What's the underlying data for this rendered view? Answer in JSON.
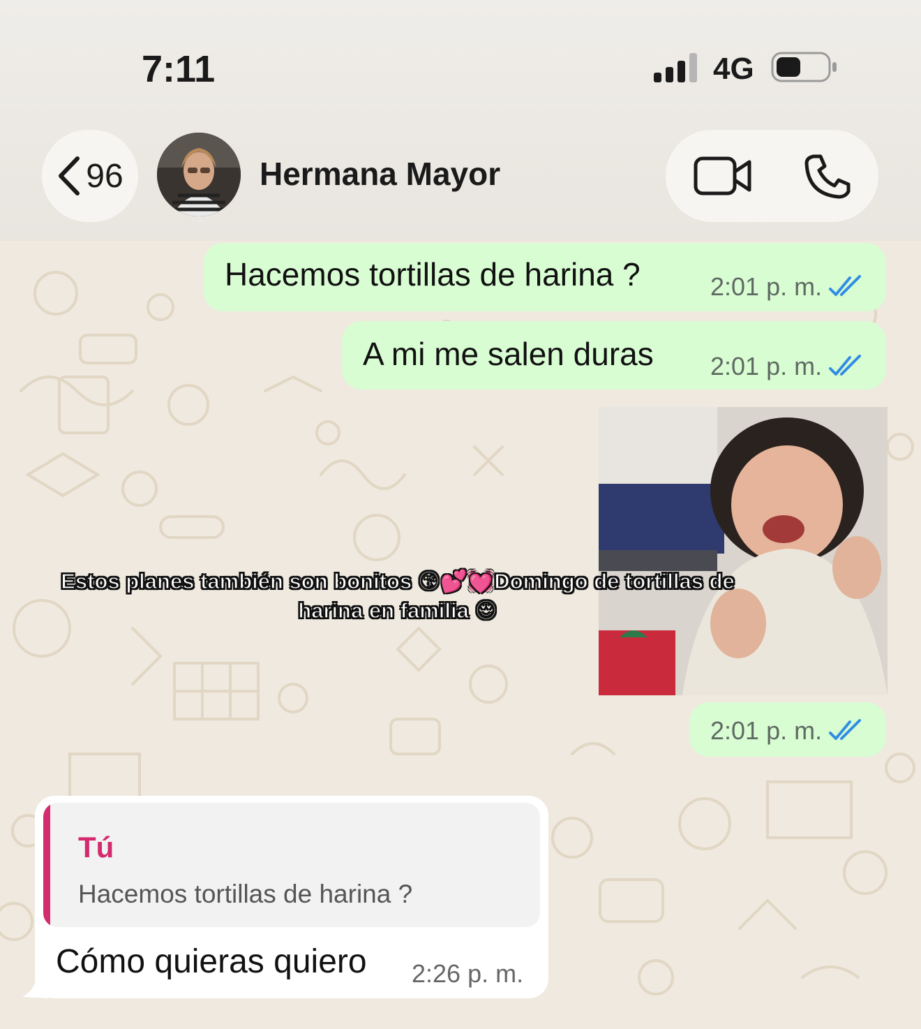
{
  "status_bar": {
    "time": "7:11",
    "network": "4G"
  },
  "header": {
    "back_count": "96",
    "contact_name": "Hermana Mayor"
  },
  "messages": [
    {
      "text": "Hacemos tortillas de harina ?",
      "time": "2:01 p. m.",
      "status": "read"
    },
    {
      "text": "A mi me salen duras",
      "time": "2:01 p. m.",
      "status": "read"
    },
    {
      "caption_line1": "Estos planes también son bonitos 😘💕💓Domingo de tortillas de",
      "caption_line2": "harina en familia 😍",
      "time": "2:01 p. m.",
      "status": "read"
    }
  ],
  "incoming": {
    "quote_author": "Tú",
    "quote_text": "Hacemos tortillas de harina ?",
    "text": "Cómo quieras quiero",
    "time": "2:26 p. m."
  },
  "colors": {
    "outgoing_bubble": "#d9fdd3",
    "read_ticks": "#2f8de4",
    "quote_accent": "#d42a6e"
  }
}
